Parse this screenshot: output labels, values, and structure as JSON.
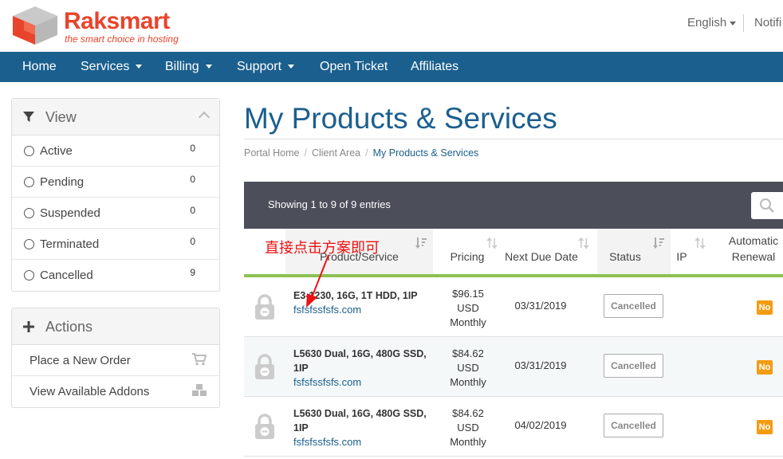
{
  "brand": {
    "name": "Raksmart",
    "tagline": "the smart choice in hosting",
    "accent": "#e8442c"
  },
  "header": {
    "language": "English",
    "notifications": "Notifi"
  },
  "nav": {
    "color": "#1b5f8e",
    "items": [
      {
        "label": "Home",
        "dropdown": false
      },
      {
        "label": "Services",
        "dropdown": true
      },
      {
        "label": "Billing",
        "dropdown": true
      },
      {
        "label": "Support",
        "dropdown": true
      },
      {
        "label": "Open Ticket",
        "dropdown": false
      },
      {
        "label": "Affiliates",
        "dropdown": false
      }
    ]
  },
  "view_panel": {
    "title": "View",
    "filters": [
      {
        "label": "Active",
        "count": "0"
      },
      {
        "label": "Pending",
        "count": "0"
      },
      {
        "label": "Suspended",
        "count": "0"
      },
      {
        "label": "Terminated",
        "count": "0"
      },
      {
        "label": "Cancelled",
        "count": "9"
      }
    ]
  },
  "actions_panel": {
    "title": "Actions",
    "items": [
      {
        "label": "Place a New Order",
        "icon": "cart-icon"
      },
      {
        "label": "View Available Addons",
        "icon": "cubes-icon"
      }
    ]
  },
  "page": {
    "title": "My Products & Services",
    "breadcrumb": [
      "Portal Home",
      "Client Area",
      "My Products & Services"
    ]
  },
  "table": {
    "info": "Showing 1 to 9 of 9 entries",
    "columns": [
      "Product/Service",
      "Pricing",
      "Next Due Date",
      "Status",
      "IP",
      "Automatic Renewal"
    ],
    "rows": [
      {
        "product": "E3-1230, 16G, 1T HDD, 1IP",
        "domain": "fsfsfssfsfs.com",
        "price": "$96.15",
        "currency": "USD",
        "cycle": "Monthly",
        "due": "03/31/2019",
        "status": "Cancelled",
        "ip": "",
        "renewal": "No"
      },
      {
        "product": "L5630 Dual, 16G, 480G SSD, 1IP",
        "domain": "fsfsfssfsfs.com",
        "price": "$84.62",
        "currency": "USD",
        "cycle": "Monthly",
        "due": "03/31/2019",
        "status": "Cancelled",
        "ip": "",
        "renewal": "No"
      },
      {
        "product": "L5630 Dual, 16G, 480G SSD, 1IP",
        "domain": "fsfsfssfsfs.com",
        "price": "$84.62",
        "currency": "USD",
        "cycle": "Monthly",
        "due": "04/02/2019",
        "status": "Cancelled",
        "ip": "",
        "renewal": "No"
      }
    ]
  },
  "annotation": {
    "text": "直接点击方案即可",
    "color": "#e11111"
  }
}
